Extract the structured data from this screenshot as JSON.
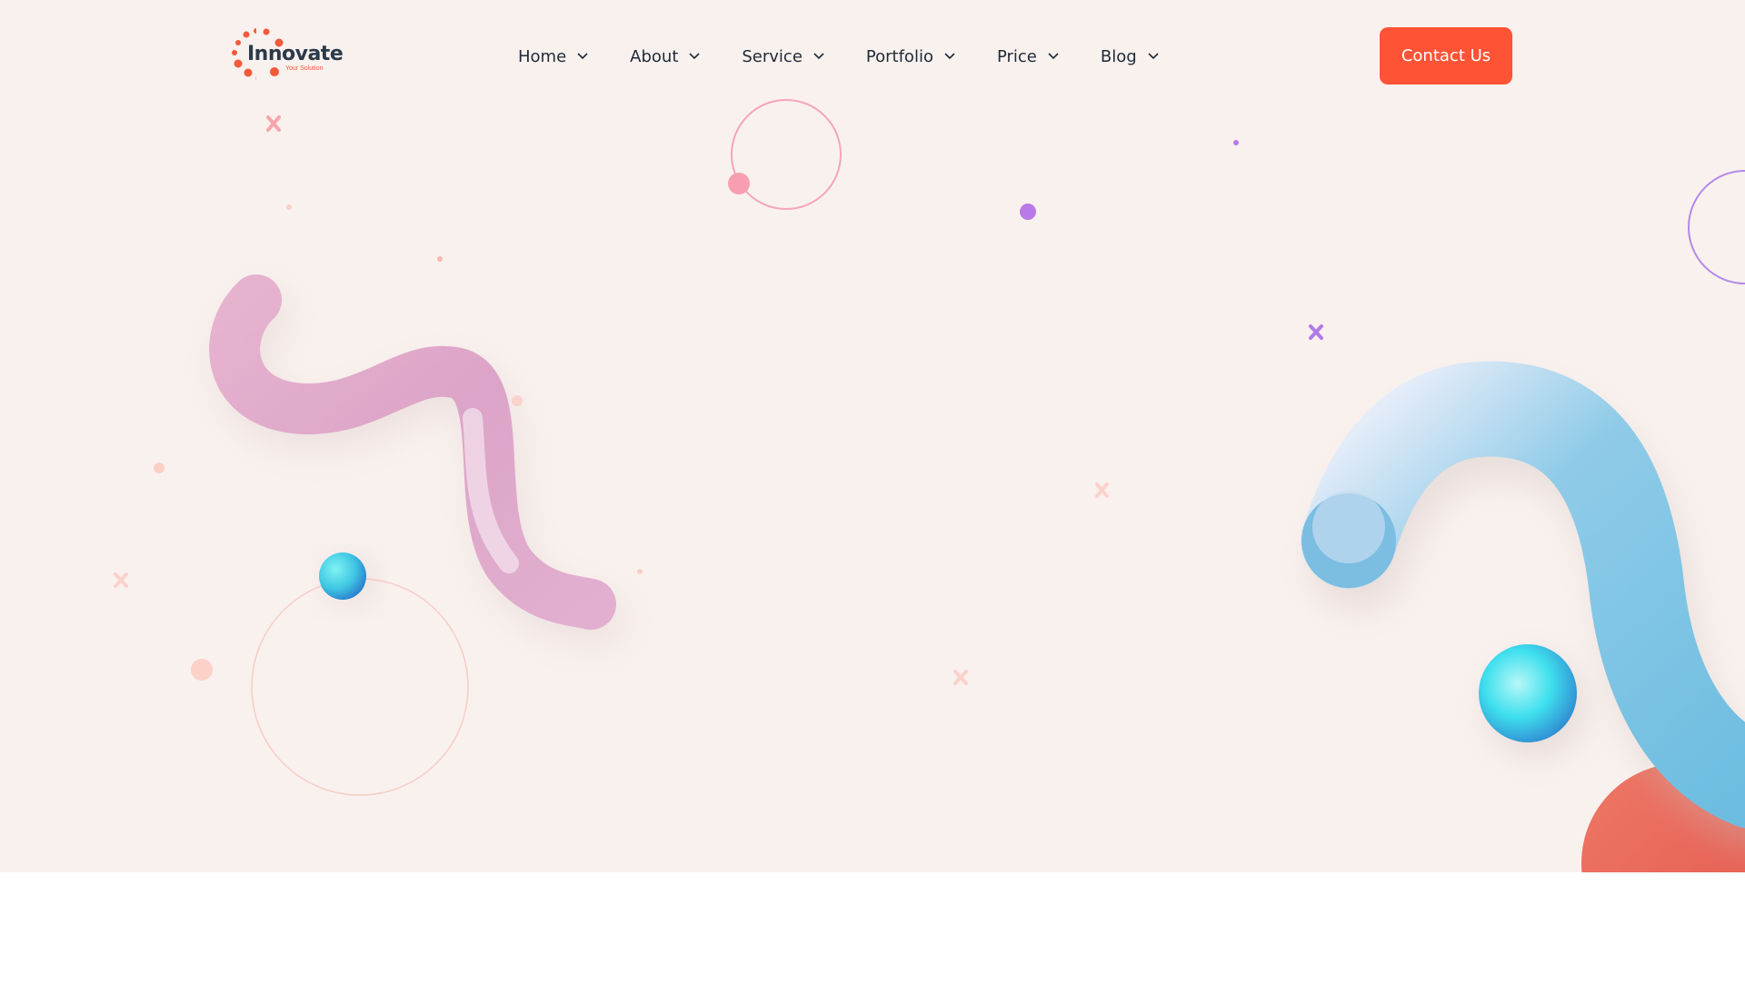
{
  "brand": {
    "name": "Innovate",
    "tagline": "Your Solution",
    "accent_color": "#fe5335"
  },
  "nav": {
    "items": [
      {
        "label": "Home",
        "icon": "chevron-down-icon"
      },
      {
        "label": "About",
        "icon": "chevron-down-icon"
      },
      {
        "label": "Service",
        "icon": "chevron-down-icon"
      },
      {
        "label": "Portfolio",
        "icon": "chevron-down-icon"
      },
      {
        "label": "Price",
        "icon": "chevron-down-icon"
      },
      {
        "label": "Blog",
        "icon": "chevron-down-icon"
      }
    ]
  },
  "cta": {
    "label": "Contact Us"
  },
  "colors": {
    "hero_background": "#f9f1ee",
    "nav_text": "#1f2a37",
    "pink_shape": "#dfa6ca",
    "blue_shape": "#6fbfe0",
    "purple_accent": "#b07ae6",
    "coral_accent": "#e8675a"
  }
}
